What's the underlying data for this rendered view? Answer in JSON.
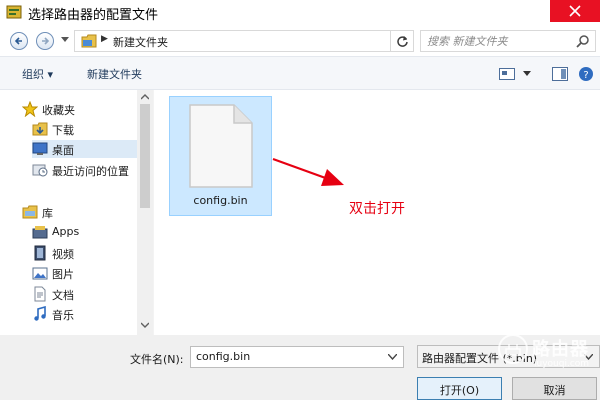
{
  "window": {
    "title": "选择路由器的配置文件"
  },
  "nav": {
    "address_path": "新建文件夹",
    "search_placeholder": "搜索 新建文件夹"
  },
  "toolbar": {
    "organize": "组织 ▾",
    "new_folder": "新建文件夹"
  },
  "sidebar": {
    "items": [
      {
        "label": "收藏夹",
        "icon": "star-icon"
      },
      {
        "label": "下载",
        "icon": "download-folder-icon"
      },
      {
        "label": "桌面",
        "icon": "desktop-icon",
        "selected": true
      },
      {
        "label": "最近访问的位置",
        "icon": "recent-places-icon"
      },
      {
        "label": "库",
        "icon": "library-icon"
      },
      {
        "label": "Apps",
        "icon": "apps-icon"
      },
      {
        "label": "视频",
        "icon": "video-icon"
      },
      {
        "label": "图片",
        "icon": "pictures-icon"
      },
      {
        "label": "文档",
        "icon": "documents-icon"
      },
      {
        "label": "音乐",
        "icon": "music-icon"
      }
    ]
  },
  "content": {
    "file": {
      "name": "config.bin",
      "icon": "file-icon"
    },
    "annotation": "双击打开"
  },
  "footer": {
    "filename_label": "文件名(N):",
    "filename_value": "config.bin",
    "filetype_value": "路由器配置文件 (*.bin)",
    "open_label": "打开(O)",
    "cancel_label": "取消"
  },
  "watermark": {
    "main": "路由器",
    "sub": "luyouqi.com"
  },
  "colors": {
    "accent": "#3c7fb1",
    "selection": "#cce8ff",
    "annotation": "#e60012",
    "close": "#e81123"
  }
}
